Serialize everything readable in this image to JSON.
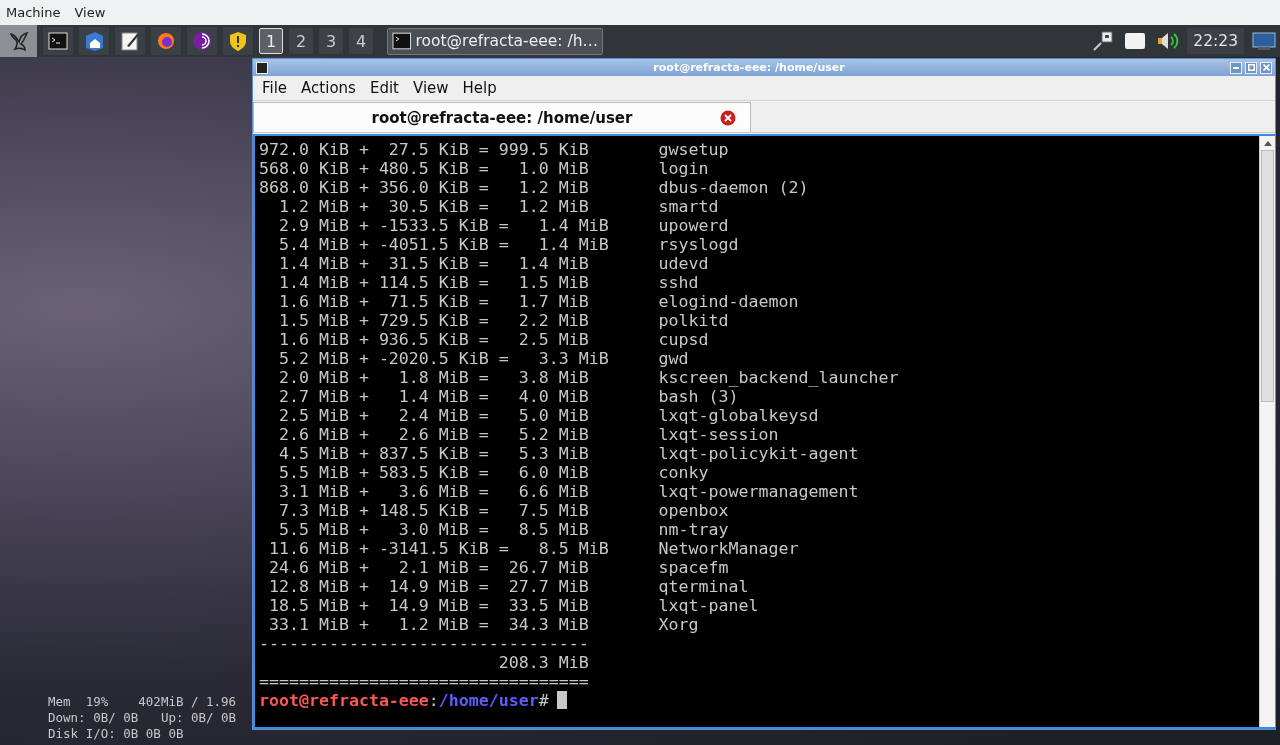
{
  "menu_bar": {
    "items": [
      "Machine",
      "View"
    ]
  },
  "taskbar": {
    "desktops": [
      {
        "label": "1",
        "selected": true
      },
      {
        "label": "2",
        "selected": false
      },
      {
        "label": "3",
        "selected": false
      },
      {
        "label": "4",
        "selected": false
      }
    ],
    "tasks": [
      {
        "label": "root@refracta-eee: /h…",
        "selected": true
      }
    ],
    "clock": "22:23"
  },
  "conky": {
    "lines": [
      "Mem  19%    402MiB / 1.96",
      "Down: 0B/ 0B   Up: 0B/ 0B",
      "Disk I/O: 0B 0B 0B"
    ]
  },
  "window": {
    "title": "root@refracta-eee: /home/user",
    "menu": [
      "File",
      "Actions",
      "Edit",
      "View",
      "Help"
    ],
    "tabs": [
      {
        "label": "root@refracta-eee: /home/user",
        "selected": true
      }
    ],
    "terminal": {
      "rows": [
        {
          "usage": "972.0 KiB +  27.5 KiB = 999.5 KiB",
          "program": "gwsetup"
        },
        {
          "usage": "568.0 KiB + 480.5 KiB =   1.0 MiB",
          "program": "login"
        },
        {
          "usage": "868.0 KiB + 356.0 KiB =   1.2 MiB",
          "program": "dbus-daemon (2)"
        },
        {
          "usage": "  1.2 MiB +  30.5 KiB =   1.2 MiB",
          "program": "smartd"
        },
        {
          "usage": "  2.9 MiB + -1533.5 KiB =   1.4 MiB",
          "program": "upowerd"
        },
        {
          "usage": "  5.4 MiB + -4051.5 KiB =   1.4 MiB",
          "program": "rsyslogd"
        },
        {
          "usage": "  1.4 MiB +  31.5 KiB =   1.4 MiB",
          "program": "udevd"
        },
        {
          "usage": "  1.4 MiB + 114.5 KiB =   1.5 MiB",
          "program": "sshd"
        },
        {
          "usage": "  1.6 MiB +  71.5 KiB =   1.7 MiB",
          "program": "elogind-daemon"
        },
        {
          "usage": "  1.5 MiB + 729.5 KiB =   2.2 MiB",
          "program": "polkitd"
        },
        {
          "usage": "  1.6 MiB + 936.5 KiB =   2.5 MiB",
          "program": "cupsd"
        },
        {
          "usage": "  5.2 MiB + -2020.5 KiB =   3.3 MiB",
          "program": "gwd"
        },
        {
          "usage": "  2.0 MiB +   1.8 MiB =   3.8 MiB",
          "program": "kscreen_backend_launcher"
        },
        {
          "usage": "  2.7 MiB +   1.4 MiB =   4.0 MiB",
          "program": "bash (3)"
        },
        {
          "usage": "  2.5 MiB +   2.4 MiB =   5.0 MiB",
          "program": "lxqt-globalkeysd"
        },
        {
          "usage": "  2.6 MiB +   2.6 MiB =   5.2 MiB",
          "program": "lxqt-session"
        },
        {
          "usage": "  4.5 MiB + 837.5 KiB =   5.3 MiB",
          "program": "lxqt-policykit-agent"
        },
        {
          "usage": "  5.5 MiB + 583.5 KiB =   6.0 MiB",
          "program": "conky"
        },
        {
          "usage": "  3.1 MiB +   3.6 MiB =   6.6 MiB",
          "program": "lxqt-powermanagement"
        },
        {
          "usage": "  7.3 MiB + 148.5 KiB =   7.5 MiB",
          "program": "openbox"
        },
        {
          "usage": "  5.5 MiB +   3.0 MiB =   8.5 MiB",
          "program": "nm-tray"
        },
        {
          "usage": " 11.6 MiB + -3141.5 KiB =   8.5 MiB",
          "program": "NetworkManager"
        },
        {
          "usage": " 24.6 MiB +   2.1 MiB =  26.7 MiB",
          "program": "spacefm"
        },
        {
          "usage": " 12.8 MiB +  14.9 MiB =  27.7 MiB",
          "program": "qterminal"
        },
        {
          "usage": " 18.5 MiB +  14.9 MiB =  33.5 MiB",
          "program": "lxqt-panel"
        },
        {
          "usage": " 33.1 MiB +   1.2 MiB =  34.3 MiB",
          "program": "Xorg"
        }
      ],
      "separator": "---------------------------------",
      "total": "                        208.3 MiB",
      "footer": "=================================",
      "prompt": {
        "user_host": "root@refracta-eee",
        "colon": ":",
        "path": "/home/user",
        "symbol": "#"
      }
    }
  }
}
